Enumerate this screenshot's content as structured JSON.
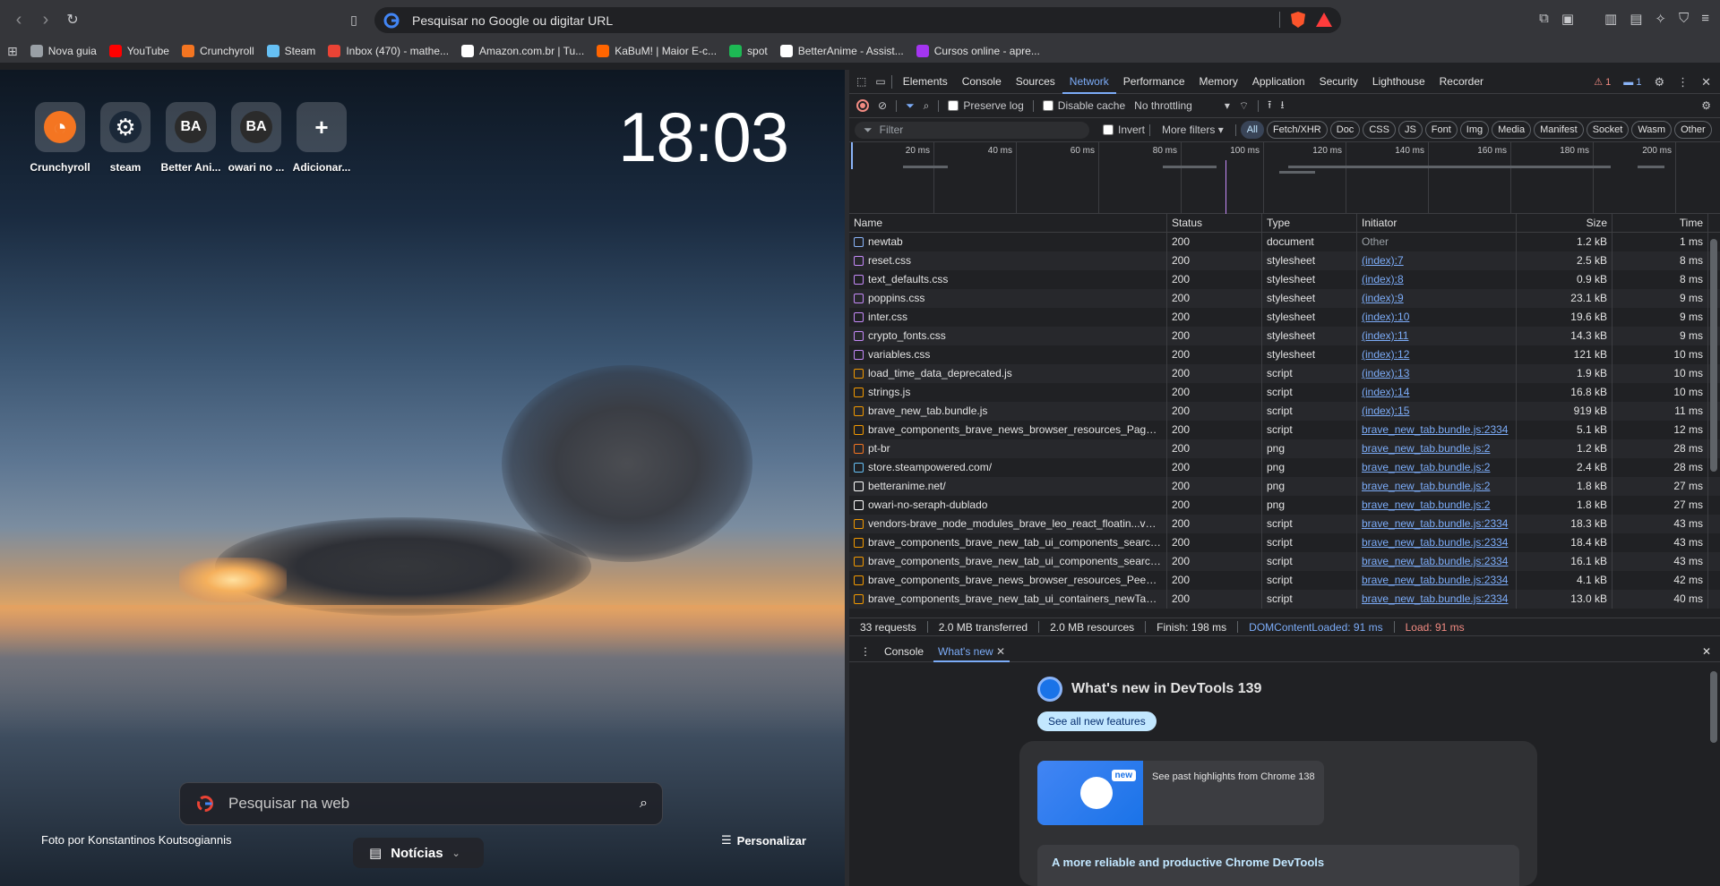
{
  "browser": {
    "address_placeholder": "Pesquisar no Google ou digitar URL",
    "bookmarks": [
      {
        "label": "Nova guia",
        "color": "#9aa0a6"
      },
      {
        "label": "YouTube",
        "color": "#ff0000"
      },
      {
        "label": "Crunchyroll",
        "color": "#f47521"
      },
      {
        "label": "Steam",
        "color": "#66c0f4"
      },
      {
        "label": "Inbox (470) - mathe...",
        "color": "#ea4335"
      },
      {
        "label": "Amazon.com.br | Tu...",
        "color": "#ffffff"
      },
      {
        "label": "KaBuM! | Maior E-c...",
        "color": "#ff6500"
      },
      {
        "label": "spot",
        "color": "#1db954"
      },
      {
        "label": "BetterAnime - Assist...",
        "color": "#ffffff"
      },
      {
        "label": "Cursos online - apre...",
        "color": "#a435f0"
      }
    ]
  },
  "newtab": {
    "clock": "18:03",
    "tiles": [
      {
        "label": "Crunchyroll",
        "glyph": "◔",
        "color": "#f47521"
      },
      {
        "label": "steam",
        "glyph": "⚙",
        "color": "#1b2838"
      },
      {
        "label": "Better Ani...",
        "glyph": "BA",
        "color": "#2b2b2b"
      },
      {
        "label": "owari no ...",
        "glyph": "BA",
        "color": "#2b2b2b"
      },
      {
        "label": "Adicionar...",
        "glyph": "+",
        "color": "transparent"
      }
    ],
    "search_placeholder": "Pesquisar na web",
    "photo_credit": "Foto por Konstantinos Koutsogiannis",
    "news_label": "Notícias",
    "customize_label": "Personalizar"
  },
  "devtools": {
    "tabs": [
      "Elements",
      "Console",
      "Sources",
      "Network",
      "Performance",
      "Memory",
      "Application",
      "Security",
      "Lighthouse",
      "Recorder"
    ],
    "active_tab": "Network",
    "warning_count": "1",
    "info_count": "1",
    "toolbar": {
      "preserve_log": "Preserve log",
      "disable_cache": "Disable cache",
      "throttling": "No throttling"
    },
    "filter": {
      "placeholder": "Filter",
      "invert": "Invert",
      "more_filters": "More filters",
      "chips": [
        "All",
        "Fetch/XHR",
        "Doc",
        "CSS",
        "JS",
        "Font",
        "Img",
        "Media",
        "Manifest",
        "Socket",
        "Wasm",
        "Other"
      ],
      "active_chip": "All"
    },
    "overview_ticks": [
      "20 ms",
      "40 ms",
      "60 ms",
      "80 ms",
      "100 ms",
      "120 ms",
      "140 ms",
      "160 ms",
      "180 ms",
      "200 ms"
    ],
    "columns": [
      "Name",
      "Status",
      "Type",
      "Initiator",
      "Size",
      "Time"
    ],
    "requests": [
      {
        "name": "newtab",
        "status": "200",
        "type": "document",
        "initiator": "Other",
        "size": "1.2 kB",
        "time": "1 ms",
        "icon": "#8ab4f8"
      },
      {
        "name": "reset.css",
        "status": "200",
        "type": "stylesheet",
        "initiator": "(index):7",
        "size": "2.5 kB",
        "time": "8 ms",
        "icon": "#c58af9"
      },
      {
        "name": "text_defaults.css",
        "status": "200",
        "type": "stylesheet",
        "initiator": "(index):8",
        "size": "0.9 kB",
        "time": "8 ms",
        "icon": "#c58af9"
      },
      {
        "name": "poppins.css",
        "status": "200",
        "type": "stylesheet",
        "initiator": "(index):9",
        "size": "23.1 kB",
        "time": "9 ms",
        "icon": "#c58af9"
      },
      {
        "name": "inter.css",
        "status": "200",
        "type": "stylesheet",
        "initiator": "(index):10",
        "size": "19.6 kB",
        "time": "9 ms",
        "icon": "#c58af9"
      },
      {
        "name": "crypto_fonts.css",
        "status": "200",
        "type": "stylesheet",
        "initiator": "(index):11",
        "size": "14.3 kB",
        "time": "9 ms",
        "icon": "#c58af9"
      },
      {
        "name": "variables.css",
        "status": "200",
        "type": "stylesheet",
        "initiator": "(index):12",
        "size": "121 kB",
        "time": "10 ms",
        "icon": "#c58af9"
      },
      {
        "name": "load_time_data_deprecated.js",
        "status": "200",
        "type": "script",
        "initiator": "(index):13",
        "size": "1.9 kB",
        "time": "10 ms",
        "icon": "#f29900"
      },
      {
        "name": "strings.js",
        "status": "200",
        "type": "script",
        "initiator": "(index):14",
        "size": "16.8 kB",
        "time": "10 ms",
        "icon": "#f29900"
      },
      {
        "name": "brave_new_tab.bundle.js",
        "status": "200",
        "type": "script",
        "initiator": "(index):15",
        "size": "919 kB",
        "time": "11 ms",
        "icon": "#f29900"
      },
      {
        "name": "brave_components_brave_news_browser_resources_Page_ts...",
        "status": "200",
        "type": "script",
        "initiator": "brave_new_tab.bundle.js:2334",
        "size": "5.1 kB",
        "time": "12 ms",
        "icon": "#f29900"
      },
      {
        "name": "pt-br",
        "status": "200",
        "type": "png",
        "initiator": "brave_new_tab.bundle.js:2",
        "size": "1.2 kB",
        "time": "28 ms",
        "icon": "#f47521"
      },
      {
        "name": "store.steampowered.com/",
        "status": "200",
        "type": "png",
        "initiator": "brave_new_tab.bundle.js:2",
        "size": "2.4 kB",
        "time": "28 ms",
        "icon": "#66c0f4"
      },
      {
        "name": "betteranime.net/",
        "status": "200",
        "type": "png",
        "initiator": "brave_new_tab.bundle.js:2",
        "size": "1.8 kB",
        "time": "27 ms",
        "icon": "#ffffff"
      },
      {
        "name": "owari-no-seraph-dublado",
        "status": "200",
        "type": "png",
        "initiator": "brave_new_tab.bundle.js:2",
        "size": "1.8 kB",
        "time": "27 ms",
        "icon": "#ffffff"
      },
      {
        "name": "vendors-brave_node_modules_brave_leo_react_floatin...ve_n...",
        "status": "200",
        "type": "script",
        "initiator": "brave_new_tab.bundle.js:2334",
        "size": "18.3 kB",
        "time": "43 ms",
        "icon": "#f29900"
      },
      {
        "name": "brave_components_brave_new_tab_ui_components_searc...n...",
        "status": "200",
        "type": "script",
        "initiator": "brave_new_tab.bundle.js:2334",
        "size": "18.4 kB",
        "time": "43 ms",
        "icon": "#f29900"
      },
      {
        "name": "brave_components_brave_new_tab_ui_components_search_...",
        "status": "200",
        "type": "script",
        "initiator": "brave_new_tab.bundle.js:2334",
        "size": "16.1 kB",
        "time": "43 ms",
        "icon": "#f29900"
      },
      {
        "name": "brave_components_brave_news_browser_resources_Peek_ts...",
        "status": "200",
        "type": "script",
        "initiator": "brave_new_tab.bundle.js:2334",
        "size": "4.1 kB",
        "time": "42 ms",
        "icon": "#f29900"
      },
      {
        "name": "brave_components_brave_new_tab_ui_containers_newTab_s...",
        "status": "200",
        "type": "script",
        "initiator": "brave_new_tab.bundle.js:2334",
        "size": "13.0 kB",
        "time": "40 ms",
        "icon": "#f29900"
      }
    ],
    "summary": {
      "requests": "33 requests",
      "transferred": "2.0 MB transferred",
      "resources": "2.0 MB resources",
      "finish": "Finish: 198 ms",
      "dcl": "DOMContentLoaded: 91 ms",
      "load": "Load: 91 ms"
    },
    "drawer": {
      "tabs": [
        "Console",
        "What's new"
      ],
      "active": "What's new",
      "title": "What's new in DevTools 139",
      "button": "See all new features",
      "new_badge": "new",
      "highlight_text": "See past highlights from Chrome 138",
      "section_title": "A more reliable and productive Chrome DevTools"
    }
  }
}
